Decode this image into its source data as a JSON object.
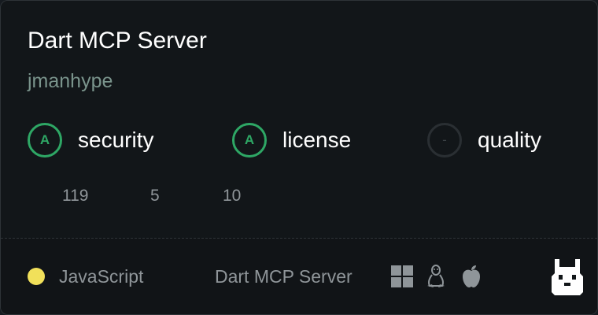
{
  "card": {
    "title": "Dart MCP Server",
    "author": "jmanhype"
  },
  "badges": [
    {
      "grade": "A",
      "label": "security",
      "color": "#2ea765"
    },
    {
      "grade": "A",
      "label": "license",
      "color": "#2ea765"
    },
    {
      "grade": "-",
      "label": "quality",
      "color": "#3c4246"
    }
  ],
  "stats": [
    "119",
    "5",
    "10"
  ],
  "footer": {
    "language": "JavaScript",
    "language_color": "#f1e05a",
    "server_name": "Dart MCP Server",
    "platforms": [
      "windows-icon",
      "linux-icon",
      "apple-icon"
    ],
    "logo": "llama-logo-icon"
  }
}
